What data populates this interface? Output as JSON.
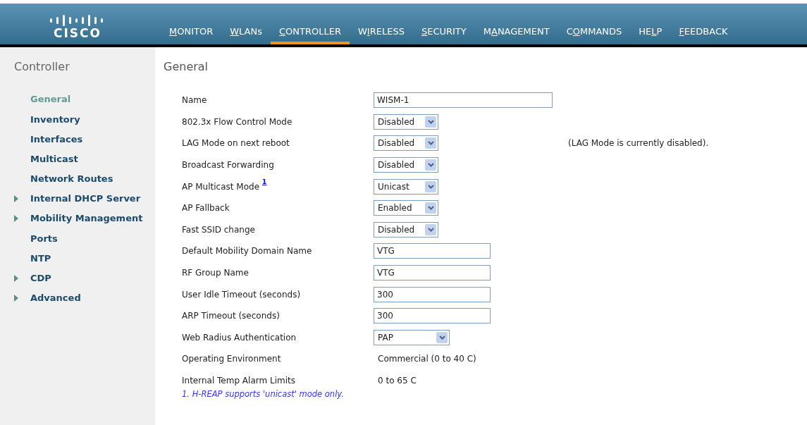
{
  "logo": {
    "text": "CISCO"
  },
  "nav": [
    {
      "key": "M",
      "after": "ONITOR",
      "selected": false
    },
    {
      "key": "W",
      "after": "LANs",
      "selected": false
    },
    {
      "key": "C",
      "after": "ONTROLLER",
      "selected": true
    },
    {
      "before": "W",
      "key": "I",
      "after": "RELESS",
      "selected": false
    },
    {
      "key": "S",
      "after": "ECURITY",
      "selected": false
    },
    {
      "before": "M",
      "key": "A",
      "after": "NAGEMENT",
      "selected": false
    },
    {
      "before": "C",
      "key": "O",
      "after": "MMANDS",
      "selected": false
    },
    {
      "before": "HE",
      "key": "L",
      "after": "P",
      "selected": false
    },
    {
      "key": "F",
      "after": "EEDBACK",
      "selected": false
    }
  ],
  "sidebar": {
    "title": "Controller",
    "items": [
      {
        "label": "General",
        "selected": true,
        "expandable": false
      },
      {
        "label": "Inventory",
        "selected": false,
        "expandable": false
      },
      {
        "label": "Interfaces",
        "selected": false,
        "expandable": false
      },
      {
        "label": "Multicast",
        "selected": false,
        "expandable": false
      },
      {
        "label": "Network Routes",
        "selected": false,
        "expandable": false
      },
      {
        "label": "Internal DHCP Server",
        "selected": false,
        "expandable": true
      },
      {
        "label": "Mobility Management",
        "selected": false,
        "expandable": true
      },
      {
        "label": "Ports",
        "selected": false,
        "expandable": false
      },
      {
        "label": "NTP",
        "selected": false,
        "expandable": false
      },
      {
        "label": "CDP",
        "selected": false,
        "expandable": true
      },
      {
        "label": "Advanced",
        "selected": false,
        "expandable": true
      }
    ]
  },
  "page_title": "General",
  "fields": [
    {
      "kind": "longtext",
      "label": "Name",
      "value": "WISM-1"
    },
    {
      "kind": "select",
      "label": "802.3x Flow Control Mode",
      "value": "Disabled"
    },
    {
      "kind": "select",
      "label": "LAG Mode on next reboot",
      "value": "Disabled",
      "note": "(LAG Mode is currently disabled)."
    },
    {
      "kind": "select",
      "label": "Broadcast Forwarding",
      "value": "Disabled"
    },
    {
      "kind": "select",
      "label": "AP Multicast Mode",
      "footnote": "1",
      "value": "Unicast"
    },
    {
      "kind": "select",
      "label": "AP Fallback",
      "value": "Enabled"
    },
    {
      "kind": "select",
      "label": "Fast SSID change",
      "value": "Disabled"
    },
    {
      "kind": "text",
      "label": "Default Mobility Domain Name",
      "value": "VTG"
    },
    {
      "kind": "text",
      "label": "RF Group Name",
      "value": "VTG"
    },
    {
      "kind": "text",
      "label": "User Idle Timeout (seconds)",
      "value": "300"
    },
    {
      "kind": "text",
      "label": "ARP Timeout (seconds)",
      "value": "300"
    },
    {
      "kind": "wideselect",
      "label": "Web Radius Authentication",
      "value": "PAP"
    },
    {
      "kind": "value",
      "label": "Operating Environment",
      "value": "Commercial (0 to 40 C)"
    },
    {
      "kind": "value",
      "label": "Internal Temp Alarm Limits",
      "value": "0 to 65 C"
    }
  ],
  "footnote": "1. H-REAP supports 'unicast' mode only."
}
